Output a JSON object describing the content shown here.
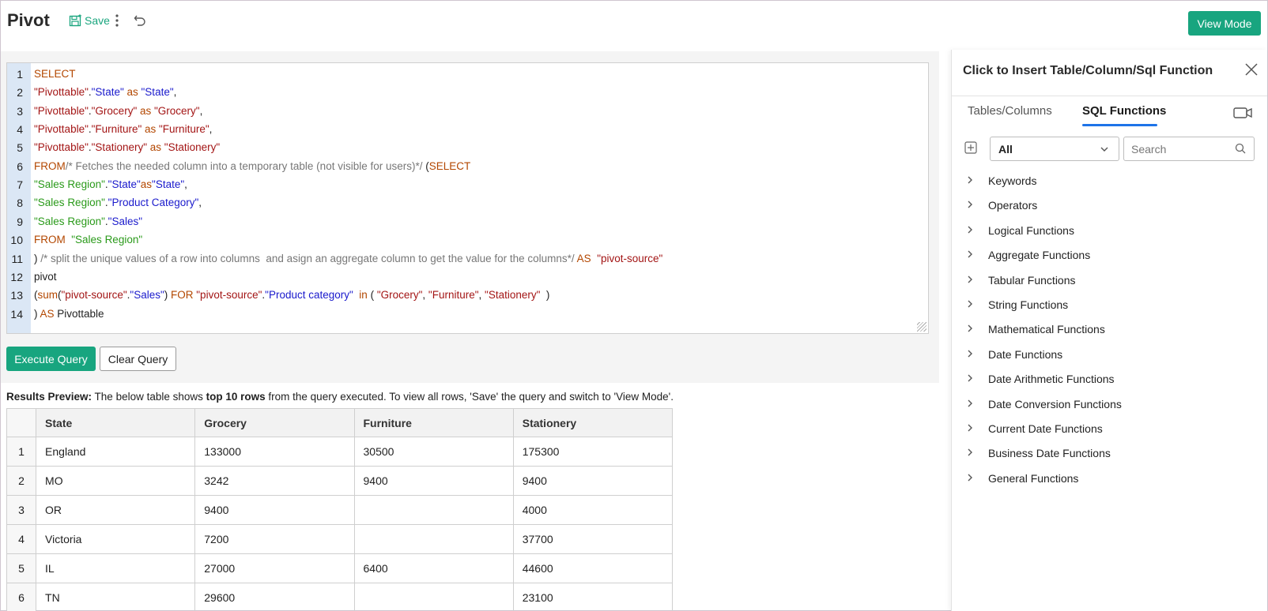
{
  "header": {
    "title": "Pivot",
    "save_label": "Save",
    "view_mode_label": "View Mode"
  },
  "editor": {
    "lines": [
      {
        "n": "1",
        "parts": [
          {
            "c": "kw",
            "t": "SELECT"
          }
        ]
      },
      {
        "n": "2",
        "parts": [
          {
            "c": "str",
            "t": "\"Pivottable\""
          },
          {
            "c": "txt",
            "t": "."
          },
          {
            "c": "col",
            "t": "\"State\""
          },
          {
            "c": "kw",
            "t": " as "
          },
          {
            "c": "col",
            "t": "\"State\""
          },
          {
            "c": "txt",
            "t": ","
          }
        ]
      },
      {
        "n": "3",
        "parts": [
          {
            "c": "str",
            "t": "\"Pivottable\""
          },
          {
            "c": "txt",
            "t": "."
          },
          {
            "c": "str",
            "t": "\"Grocery\""
          },
          {
            "c": "kw",
            "t": " as "
          },
          {
            "c": "str",
            "t": "\"Grocery\""
          },
          {
            "c": "txt",
            "t": ","
          }
        ]
      },
      {
        "n": "4",
        "parts": [
          {
            "c": "str",
            "t": "\"Pivottable\""
          },
          {
            "c": "txt",
            "t": "."
          },
          {
            "c": "str",
            "t": "\"Furniture\""
          },
          {
            "c": "kw",
            "t": " as "
          },
          {
            "c": "str",
            "t": "\"Furniture\""
          },
          {
            "c": "txt",
            "t": ","
          }
        ]
      },
      {
        "n": "5",
        "parts": [
          {
            "c": "str",
            "t": "\"Pivottable\""
          },
          {
            "c": "txt",
            "t": "."
          },
          {
            "c": "str",
            "t": "\"Stationery\""
          },
          {
            "c": "kw",
            "t": " as "
          },
          {
            "c": "str",
            "t": "\"Stationery\""
          }
        ]
      },
      {
        "n": "6",
        "parts": [
          {
            "c": "kw",
            "t": "FROM"
          },
          {
            "c": "cmt",
            "t": "/* Fetches the needed column into a temporary table (not visible for users)*/ "
          },
          {
            "c": "txt",
            "t": "("
          },
          {
            "c": "kw",
            "t": "SELECT"
          }
        ]
      },
      {
        "n": "7",
        "parts": [
          {
            "c": "grn",
            "t": "\"Sales Region\""
          },
          {
            "c": "txt",
            "t": "."
          },
          {
            "c": "col",
            "t": "\"State\""
          },
          {
            "c": "kw",
            "t": "as"
          },
          {
            "c": "col",
            "t": "\"State\""
          },
          {
            "c": "txt",
            "t": ","
          }
        ]
      },
      {
        "n": "8",
        "parts": [
          {
            "c": "grn",
            "t": "\"Sales Region\""
          },
          {
            "c": "txt",
            "t": "."
          },
          {
            "c": "col",
            "t": "\"Product Category\""
          },
          {
            "c": "txt",
            "t": ","
          }
        ]
      },
      {
        "n": "9",
        "parts": [
          {
            "c": "grn",
            "t": "\"Sales Region\""
          },
          {
            "c": "txt",
            "t": "."
          },
          {
            "c": "col",
            "t": "\"Sales\""
          }
        ]
      },
      {
        "n": "10",
        "parts": [
          {
            "c": "kw",
            "t": "FROM  "
          },
          {
            "c": "grn",
            "t": "\"Sales Region\""
          }
        ]
      },
      {
        "n": "11",
        "parts": [
          {
            "c": "txt",
            "t": ") "
          },
          {
            "c": "cmt",
            "t": "/* split the unique values of a row into columns  and asign an aggregate column to get the value for the columns*/ "
          },
          {
            "c": "kw",
            "t": "AS  "
          },
          {
            "c": "str",
            "t": "\"pivot-source\""
          }
        ]
      },
      {
        "n": "12",
        "parts": [
          {
            "c": "txt",
            "t": "pivot"
          }
        ]
      },
      {
        "n": "13",
        "parts": [
          {
            "c": "txt",
            "t": "("
          },
          {
            "c": "kw",
            "t": "sum"
          },
          {
            "c": "txt",
            "t": "("
          },
          {
            "c": "str",
            "t": "\"pivot-source\""
          },
          {
            "c": "txt",
            "t": "."
          },
          {
            "c": "col",
            "t": "\"Sales\""
          },
          {
            "c": "txt",
            "t": ") "
          },
          {
            "c": "kw",
            "t": "FOR "
          },
          {
            "c": "str",
            "t": "\"pivot-source\""
          },
          {
            "c": "txt",
            "t": "."
          },
          {
            "c": "col",
            "t": "\"Product category\""
          },
          {
            "c": "kw",
            "t": "  in "
          },
          {
            "c": "txt",
            "t": "( "
          },
          {
            "c": "str",
            "t": "\"Grocery\""
          },
          {
            "c": "txt",
            "t": ", "
          },
          {
            "c": "str",
            "t": "\"Furniture\""
          },
          {
            "c": "txt",
            "t": ", "
          },
          {
            "c": "str",
            "t": "\"Stationery\""
          },
          {
            "c": "txt",
            "t": "  )"
          }
        ]
      },
      {
        "n": "14",
        "parts": [
          {
            "c": "txt",
            "t": ") "
          },
          {
            "c": "kw",
            "t": "AS "
          },
          {
            "c": "txt",
            "t": "Pivottable"
          }
        ]
      }
    ]
  },
  "actions": {
    "execute_label": "Execute Query",
    "clear_label": "Clear Query"
  },
  "results": {
    "preview_label": "Results Preview:",
    "preview_text_1": " The below table shows ",
    "preview_bold": "top 10 rows",
    "preview_text_2": " from the query executed. To view all rows, 'Save' the query and switch to 'View Mode'.",
    "columns": [
      "State",
      "Grocery",
      "Furniture",
      "Stationery"
    ],
    "rows": [
      [
        "1",
        "England",
        "133000",
        "30500",
        "175300"
      ],
      [
        "2",
        "MO",
        "3242",
        "9400",
        "9400"
      ],
      [
        "3",
        "OR",
        "9400",
        "",
        "4000"
      ],
      [
        "4",
        "Victoria",
        "7200",
        "",
        "37700"
      ],
      [
        "5",
        "IL",
        "27000",
        "6400",
        "44600"
      ],
      [
        "6",
        "TN",
        "29600",
        "",
        "23100"
      ]
    ]
  },
  "panel": {
    "title": "Click to Insert Table/Column/Sql Function",
    "tabs": [
      "Tables/Columns",
      "SQL Functions"
    ],
    "active_tab": "SQL Functions",
    "filter_value": "All",
    "search_placeholder": "Search",
    "items": [
      "Keywords",
      "Operators",
      "Logical Functions",
      "Aggregate Functions",
      "Tabular Functions",
      "String Functions",
      "Mathematical Functions",
      "Date Functions",
      "Date Arithmetic Functions",
      "Date Conversion Functions",
      "Current Date Functions",
      "Business Date Functions",
      "General Functions"
    ]
  },
  "colors": {
    "accent": "#18a57f",
    "tab_underline": "#1d73e8",
    "keyword": "#b34700",
    "string": "#a31515",
    "column": "#1a1acc",
    "table_green": "#2a9a1a",
    "comment": "#777777"
  }
}
